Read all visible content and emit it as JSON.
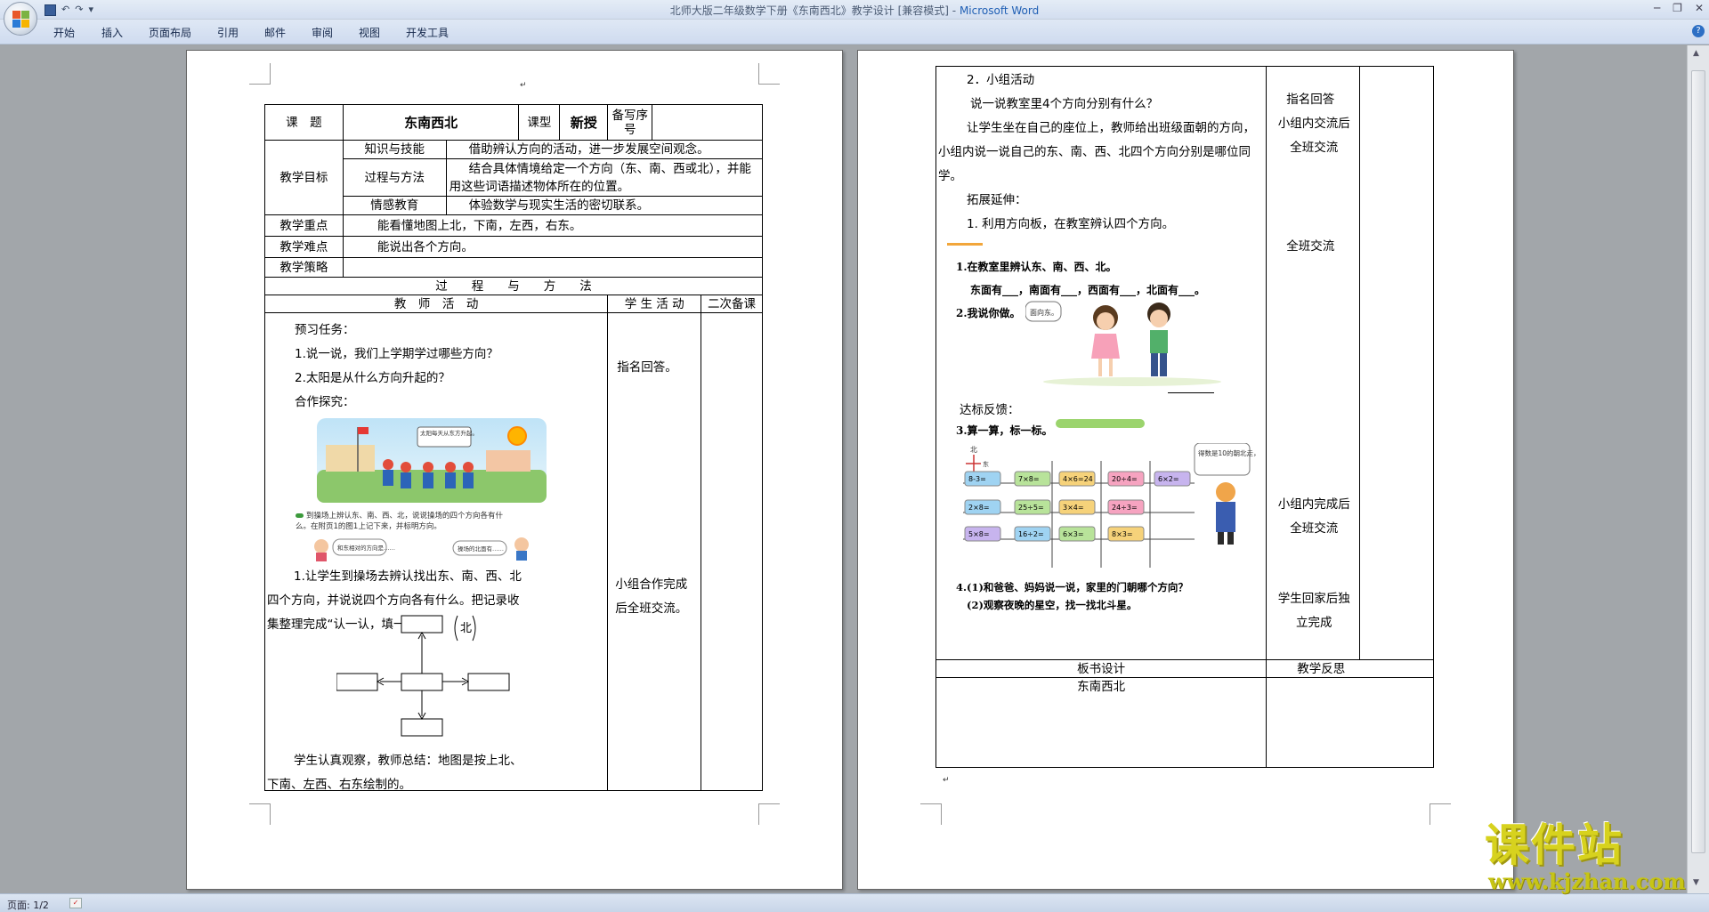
{
  "window": {
    "title": "北师大版二年级数学下册《东南西北》教学设计 [兼容模式]",
    "app": "Microsoft Word",
    "separator": " - "
  },
  "qat": {
    "undo": "↶",
    "redo": "↷",
    "more": "▾"
  },
  "tabs": [
    "开始",
    "插入",
    "页面布局",
    "引用",
    "邮件",
    "审阅",
    "视图",
    "开发工具"
  ],
  "status": {
    "page": "页面: 1/2"
  },
  "watermark": {
    "big": "课件站",
    "small": "www.kjzhan.com"
  },
  "mark": "↵",
  "page1": {
    "header_row": {
      "topic_label": "课　题",
      "topic": "东南西北",
      "type_label": "课型",
      "type": "新授",
      "seq_label": "备写序号"
    },
    "goals_label": "教学目标",
    "goals": [
      {
        "name": "知识与技能",
        "text": "借助辨认方向的活动，进一步发展空间观念。"
      },
      {
        "name": "过程与方法",
        "text": "结合具体情境给定一个方向（东、南、西或北），并能用这些词语描述物体所在的位置。"
      },
      {
        "name": "情感教育",
        "text": "体验数学与现实生活的密切联系。"
      }
    ],
    "key_label": "教学重点",
    "key": "能看懂地图上北，下南，左西，右东。",
    "diff_label": "教学难点",
    "diff": "能说出各个方向。",
    "strategy_label": "教学策略",
    "process_label": "过　　程　　与　　方　　法",
    "teacher_label": "教　师　活　动",
    "student_label": "学 生 活 动",
    "second_label": "二次备课",
    "teacher": {
      "preview": "预习任务：",
      "q1": "1.说一说，我们上学期学过哪些方向？",
      "q2": "2.太阳是从什么方向升起的？",
      "explore": "合作探究：",
      "img_bubble": "太阳每天从东方升起。",
      "caption": "到操场上辨认东、南、西、北，说说操场的四个方向各有什么。在附页1的图1上记下来，并标明方向。",
      "bubble2": "和东相对的方向是……",
      "bubble3": "操场的北面有……",
      "task1": "1.让学生到操场去辨认找出东、南、西、北四个方向，并说说四个方向各有什么。把记录收集整理完成“认一认，填一填”。",
      "north": "北",
      "summary": "学生认真观察，教师总结：地图是按上北、下南、左西、右东绘制的。"
    },
    "student": {
      "a1": "指名回答。",
      "a2": "小组合作完成后全班交流。"
    }
  },
  "page2": {
    "teacher": {
      "group": "2．小组活动",
      "group_q": "说一说教室里4个方向分别有什么？",
      "group_desc": "让学生坐在自己的座位上，教师给出班级面朝的方向，小组内说一说自己的东、南、西、北四个方向分别是哪位同学。",
      "extend": "拓展延伸：",
      "extend1": "1. 利用方向板，在教室辨认四个方向。",
      "ex1": "1.在教室里辨认东、南、西、北。",
      "ex1b": "东面有___，南面有___，西面有___，北面有___。",
      "ex2": "2.我说你做。",
      "ex2_bubble": "面向东。",
      "check": "达标反馈：",
      "ex3": "3.算一算，标一标。",
      "ex3_bubble": "得数是10的朝北走，其余的朝西走。",
      "maze": [
        "8-3=",
        "7×8=",
        "4×6=24",
        "20÷4=",
        "6×2=",
        "2×8=",
        "25÷5=",
        "3×4=",
        "24÷3=",
        "5×8=",
        "16÷2=",
        "6×3=",
        "8×3="
      ],
      "compass_n": "北",
      "compass_e": "东",
      "ex4a": "4.(1)和爸爸、妈妈说一说，家里的门朝哪个方向？",
      "ex4b": "(2)观察夜晚的星空，找一找北斗星。"
    },
    "student": {
      "s1": "指名回答",
      "s2": "小组内交流后全班交流",
      "s3": "全班交流",
      "s4": "小组内完成后全班交流",
      "s5": "学生回家后独立完成"
    },
    "board_label": "板书设计",
    "reflect_label": "教学反思",
    "board": "东南西北"
  }
}
